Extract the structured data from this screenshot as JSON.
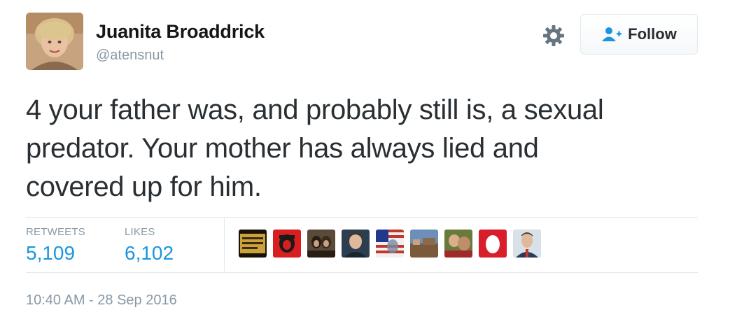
{
  "user": {
    "name": "Juanita Broaddrick",
    "handle": "@atensnut",
    "avatar_icon": "profile-photo-icon"
  },
  "actions": {
    "settings_icon": "gear-icon",
    "follow_label": "Follow",
    "follow_icon": "add-person-icon"
  },
  "tweet": {
    "text_lines": [
      "4  your father was, and probably still is, a sexual",
      "predator. Your mother has always lied and",
      "covered up for him."
    ]
  },
  "stats": {
    "retweets_label": "RETWEETS",
    "retweets_value": "5,109",
    "likes_label": "LIKES",
    "likes_value": "6,102"
  },
  "likers": [
    {
      "icon": "liker-avatar-1"
    },
    {
      "icon": "liker-avatar-2"
    },
    {
      "icon": "liker-avatar-3"
    },
    {
      "icon": "liker-avatar-4"
    },
    {
      "icon": "liker-avatar-5"
    },
    {
      "icon": "liker-avatar-6"
    },
    {
      "icon": "liker-avatar-7"
    },
    {
      "icon": "liker-avatar-8"
    },
    {
      "icon": "liker-avatar-9"
    }
  ],
  "timestamp": "10:40 AM - 28 Sep 2016",
  "colors": {
    "link_blue": "#1b95e0",
    "muted_gray": "#8899a6",
    "text_dark": "#292f33",
    "border": "#e1e8ed"
  }
}
